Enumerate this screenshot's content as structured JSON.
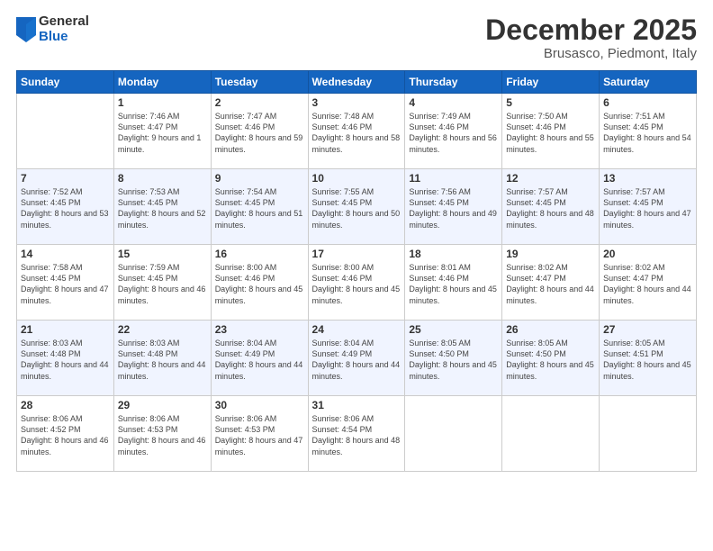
{
  "logo": {
    "general": "General",
    "blue": "Blue"
  },
  "title": "December 2025",
  "subtitle": "Brusasco, Piedmont, Italy",
  "days_header": [
    "Sunday",
    "Monday",
    "Tuesday",
    "Wednesday",
    "Thursday",
    "Friday",
    "Saturday"
  ],
  "weeks": [
    [
      {
        "day": "",
        "sunrise": "",
        "sunset": "",
        "daylight": ""
      },
      {
        "day": "1",
        "sunrise": "Sunrise: 7:46 AM",
        "sunset": "Sunset: 4:47 PM",
        "daylight": "Daylight: 9 hours and 1 minute."
      },
      {
        "day": "2",
        "sunrise": "Sunrise: 7:47 AM",
        "sunset": "Sunset: 4:46 PM",
        "daylight": "Daylight: 8 hours and 59 minutes."
      },
      {
        "day": "3",
        "sunrise": "Sunrise: 7:48 AM",
        "sunset": "Sunset: 4:46 PM",
        "daylight": "Daylight: 8 hours and 58 minutes."
      },
      {
        "day": "4",
        "sunrise": "Sunrise: 7:49 AM",
        "sunset": "Sunset: 4:46 PM",
        "daylight": "Daylight: 8 hours and 56 minutes."
      },
      {
        "day": "5",
        "sunrise": "Sunrise: 7:50 AM",
        "sunset": "Sunset: 4:46 PM",
        "daylight": "Daylight: 8 hours and 55 minutes."
      },
      {
        "day": "6",
        "sunrise": "Sunrise: 7:51 AM",
        "sunset": "Sunset: 4:45 PM",
        "daylight": "Daylight: 8 hours and 54 minutes."
      }
    ],
    [
      {
        "day": "7",
        "sunrise": "Sunrise: 7:52 AM",
        "sunset": "Sunset: 4:45 PM",
        "daylight": "Daylight: 8 hours and 53 minutes."
      },
      {
        "day": "8",
        "sunrise": "Sunrise: 7:53 AM",
        "sunset": "Sunset: 4:45 PM",
        "daylight": "Daylight: 8 hours and 52 minutes."
      },
      {
        "day": "9",
        "sunrise": "Sunrise: 7:54 AM",
        "sunset": "Sunset: 4:45 PM",
        "daylight": "Daylight: 8 hours and 51 minutes."
      },
      {
        "day": "10",
        "sunrise": "Sunrise: 7:55 AM",
        "sunset": "Sunset: 4:45 PM",
        "daylight": "Daylight: 8 hours and 50 minutes."
      },
      {
        "day": "11",
        "sunrise": "Sunrise: 7:56 AM",
        "sunset": "Sunset: 4:45 PM",
        "daylight": "Daylight: 8 hours and 49 minutes."
      },
      {
        "day": "12",
        "sunrise": "Sunrise: 7:57 AM",
        "sunset": "Sunset: 4:45 PM",
        "daylight": "Daylight: 8 hours and 48 minutes."
      },
      {
        "day": "13",
        "sunrise": "Sunrise: 7:57 AM",
        "sunset": "Sunset: 4:45 PM",
        "daylight": "Daylight: 8 hours and 47 minutes."
      }
    ],
    [
      {
        "day": "14",
        "sunrise": "Sunrise: 7:58 AM",
        "sunset": "Sunset: 4:45 PM",
        "daylight": "Daylight: 8 hours and 47 minutes."
      },
      {
        "day": "15",
        "sunrise": "Sunrise: 7:59 AM",
        "sunset": "Sunset: 4:45 PM",
        "daylight": "Daylight: 8 hours and 46 minutes."
      },
      {
        "day": "16",
        "sunrise": "Sunrise: 8:00 AM",
        "sunset": "Sunset: 4:46 PM",
        "daylight": "Daylight: 8 hours and 45 minutes."
      },
      {
        "day": "17",
        "sunrise": "Sunrise: 8:00 AM",
        "sunset": "Sunset: 4:46 PM",
        "daylight": "Daylight: 8 hours and 45 minutes."
      },
      {
        "day": "18",
        "sunrise": "Sunrise: 8:01 AM",
        "sunset": "Sunset: 4:46 PM",
        "daylight": "Daylight: 8 hours and 45 minutes."
      },
      {
        "day": "19",
        "sunrise": "Sunrise: 8:02 AM",
        "sunset": "Sunset: 4:47 PM",
        "daylight": "Daylight: 8 hours and 44 minutes."
      },
      {
        "day": "20",
        "sunrise": "Sunrise: 8:02 AM",
        "sunset": "Sunset: 4:47 PM",
        "daylight": "Daylight: 8 hours and 44 minutes."
      }
    ],
    [
      {
        "day": "21",
        "sunrise": "Sunrise: 8:03 AM",
        "sunset": "Sunset: 4:48 PM",
        "daylight": "Daylight: 8 hours and 44 minutes."
      },
      {
        "day": "22",
        "sunrise": "Sunrise: 8:03 AM",
        "sunset": "Sunset: 4:48 PM",
        "daylight": "Daylight: 8 hours and 44 minutes."
      },
      {
        "day": "23",
        "sunrise": "Sunrise: 8:04 AM",
        "sunset": "Sunset: 4:49 PM",
        "daylight": "Daylight: 8 hours and 44 minutes."
      },
      {
        "day": "24",
        "sunrise": "Sunrise: 8:04 AM",
        "sunset": "Sunset: 4:49 PM",
        "daylight": "Daylight: 8 hours and 44 minutes."
      },
      {
        "day": "25",
        "sunrise": "Sunrise: 8:05 AM",
        "sunset": "Sunset: 4:50 PM",
        "daylight": "Daylight: 8 hours and 45 minutes."
      },
      {
        "day": "26",
        "sunrise": "Sunrise: 8:05 AM",
        "sunset": "Sunset: 4:50 PM",
        "daylight": "Daylight: 8 hours and 45 minutes."
      },
      {
        "day": "27",
        "sunrise": "Sunrise: 8:05 AM",
        "sunset": "Sunset: 4:51 PM",
        "daylight": "Daylight: 8 hours and 45 minutes."
      }
    ],
    [
      {
        "day": "28",
        "sunrise": "Sunrise: 8:06 AM",
        "sunset": "Sunset: 4:52 PM",
        "daylight": "Daylight: 8 hours and 46 minutes."
      },
      {
        "day": "29",
        "sunrise": "Sunrise: 8:06 AM",
        "sunset": "Sunset: 4:53 PM",
        "daylight": "Daylight: 8 hours and 46 minutes."
      },
      {
        "day": "30",
        "sunrise": "Sunrise: 8:06 AM",
        "sunset": "Sunset: 4:53 PM",
        "daylight": "Daylight: 8 hours and 47 minutes."
      },
      {
        "day": "31",
        "sunrise": "Sunrise: 8:06 AM",
        "sunset": "Sunset: 4:54 PM",
        "daylight": "Daylight: 8 hours and 48 minutes."
      },
      {
        "day": "",
        "sunrise": "",
        "sunset": "",
        "daylight": ""
      },
      {
        "day": "",
        "sunrise": "",
        "sunset": "",
        "daylight": ""
      },
      {
        "day": "",
        "sunrise": "",
        "sunset": "",
        "daylight": ""
      }
    ]
  ]
}
